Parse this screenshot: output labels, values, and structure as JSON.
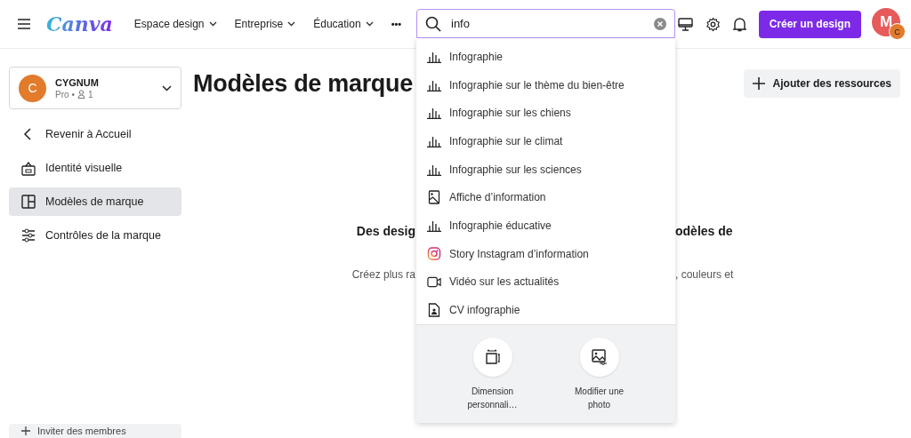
{
  "header": {
    "logo": "Canva",
    "nav": [
      {
        "label": "Espace design"
      },
      {
        "label": "Entreprise"
      },
      {
        "label": "Éducation"
      }
    ],
    "more": "•••",
    "create_button": "Créer un design",
    "avatar": {
      "initial": "M",
      "badge": "C"
    }
  },
  "search": {
    "value": "info",
    "suggestions": [
      {
        "kind": "chart",
        "label": "Infographie"
      },
      {
        "kind": "chart",
        "label": "Infographie sur le thème du bien-être"
      },
      {
        "kind": "chart",
        "label": "Infographie sur les chiens"
      },
      {
        "kind": "chart",
        "label": "Infographie sur le climat"
      },
      {
        "kind": "chart",
        "label": "Infographie sur les sciences"
      },
      {
        "kind": "poster",
        "label": "Affiche d’information"
      },
      {
        "kind": "chart",
        "label": "Infographie éducative"
      },
      {
        "kind": "instagram",
        "label": "Story Instagram d’information"
      },
      {
        "kind": "video",
        "label": "Vidéo sur les actualités"
      },
      {
        "kind": "document",
        "label": "CV infographie"
      }
    ],
    "actions": [
      {
        "kind": "resize",
        "label": "Dimension personnali…"
      },
      {
        "kind": "photo",
        "label": "Modifier une photo"
      }
    ]
  },
  "sidebar": {
    "brand": {
      "initial": "C",
      "name": "CYGNUM",
      "plan": "Pro",
      "separator": "•",
      "members": "1"
    },
    "items": [
      {
        "kind": "back",
        "label": "Revenir à Accueil",
        "selected": false
      },
      {
        "kind": "identity",
        "label": "Identité visuelle",
        "selected": false
      },
      {
        "kind": "templates",
        "label": "Modèles de marque",
        "selected": true
      },
      {
        "kind": "controls",
        "label": "Contrôles de la marque",
        "selected": false
      }
    ],
    "invite": "Inviter des membres"
  },
  "main": {
    "title": "Modèles de marque",
    "add_button": "Ajouter des ressources",
    "heading_left": "Des desig",
    "heading_right": "odèles de",
    "text_left": "Créez plus ra",
    "text_right": ", couleurs et"
  }
}
